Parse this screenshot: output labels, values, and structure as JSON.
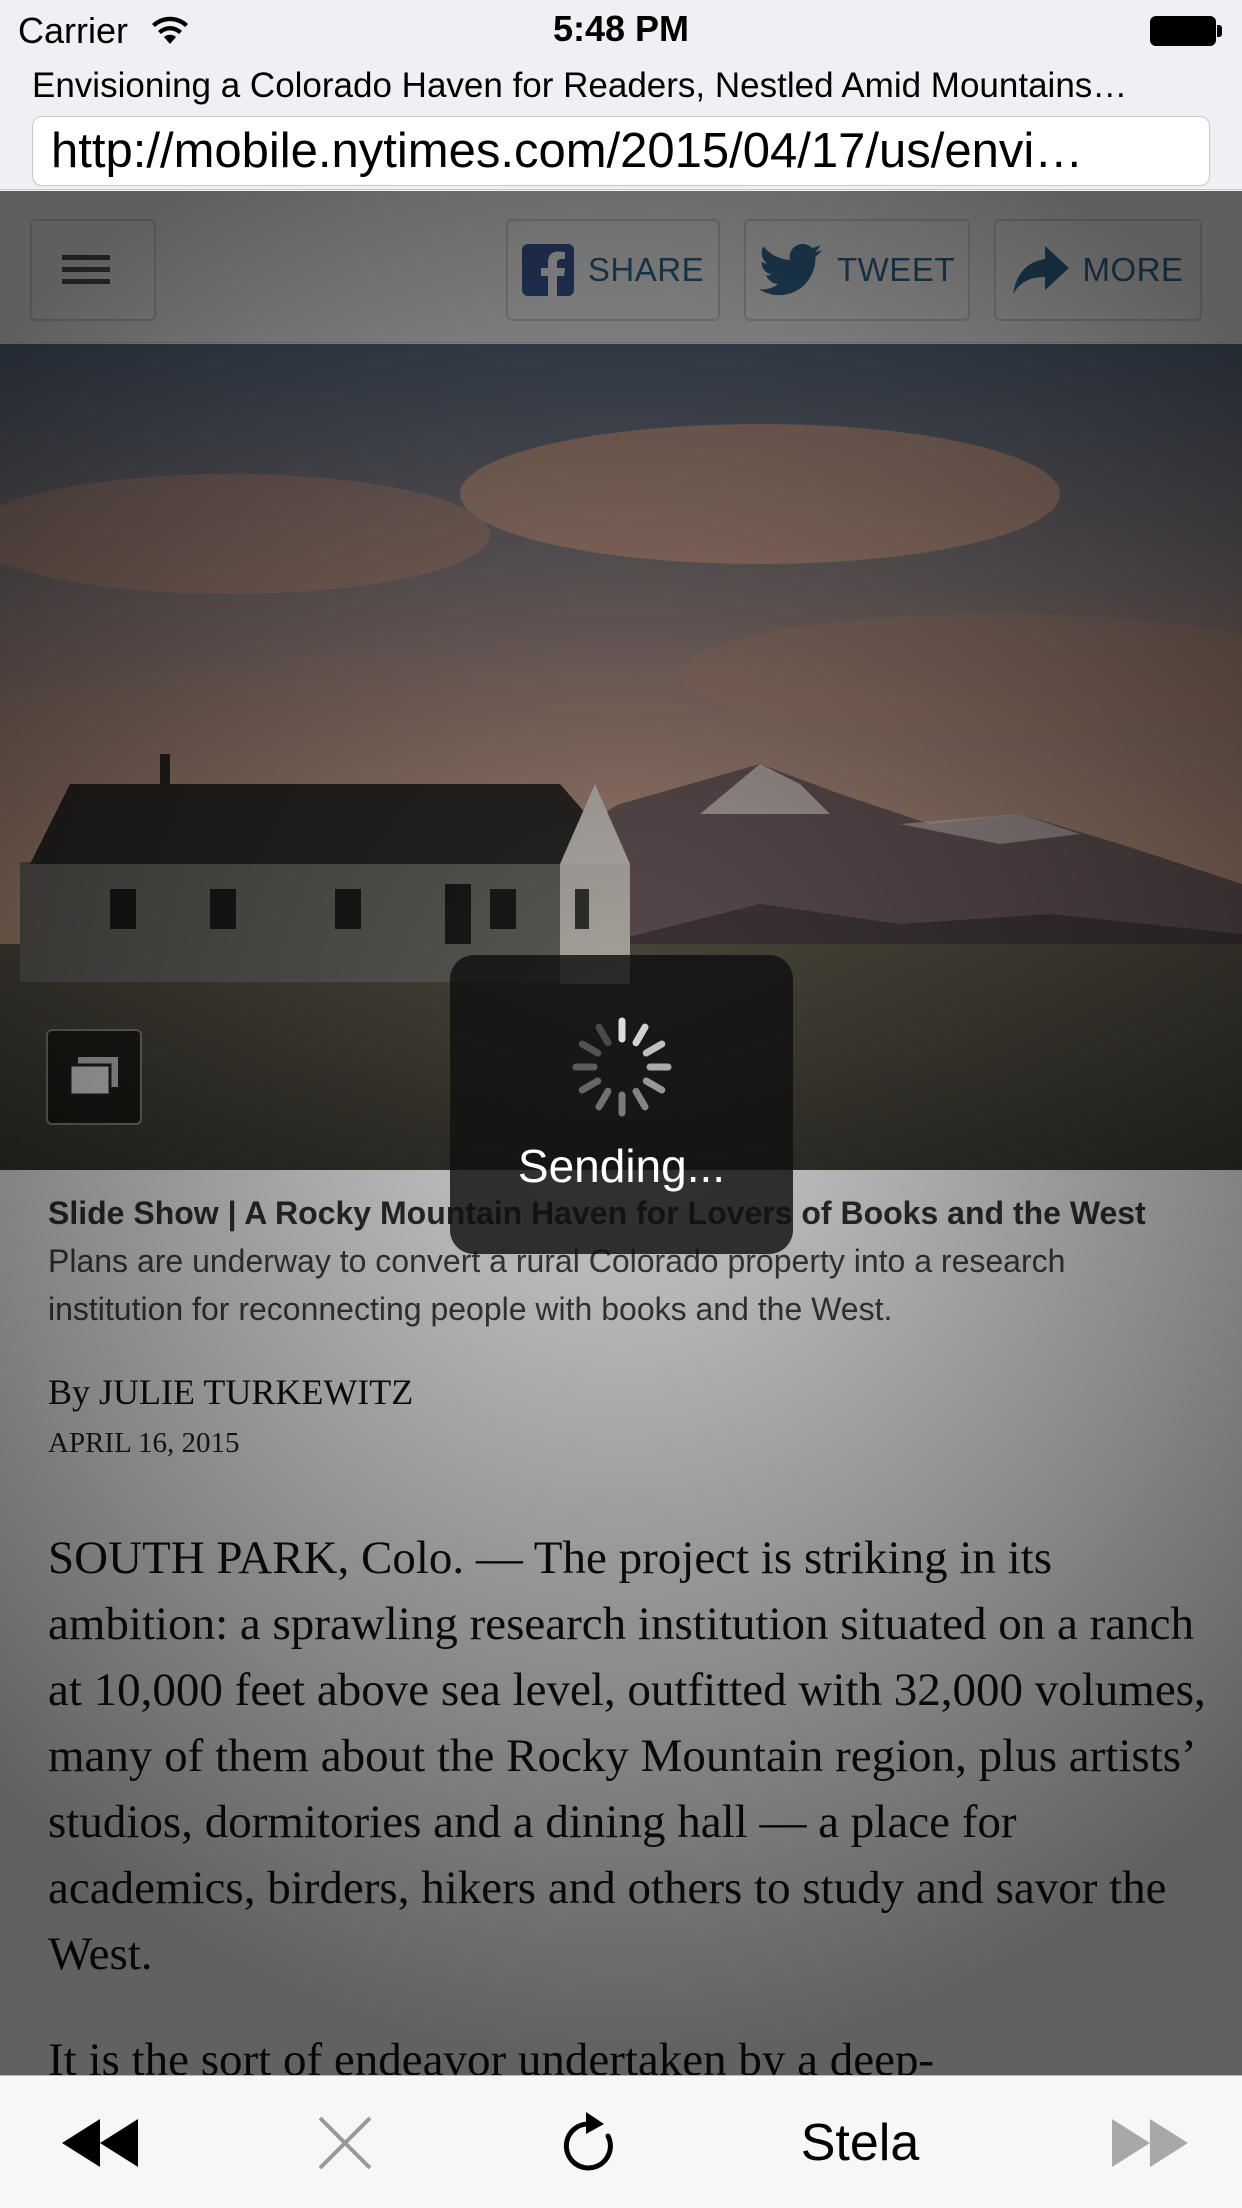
{
  "status_bar": {
    "carrier": "Carrier",
    "time": "5:48 PM",
    "wifi_icon": "wifi-icon",
    "battery_icon": "battery-icon"
  },
  "browser": {
    "page_title": "Envisioning a Colorado Haven for Readers, Nestled Amid Mountains…",
    "url": "http://mobile.nytimes.com/2015/04/17/us/envi…"
  },
  "nyt_toolbar": {
    "menu_icon": "hamburger-menu-icon",
    "share_label": "SHARE",
    "tweet_label": "TWEET",
    "more_label": "MORE"
  },
  "article": {
    "caption_title": "Slide Show | A Rocky Mountain Haven for Lovers of Books and the West",
    "caption_text": " Plans are underway to convert a rural Colorado property into a research institution for reconnecting people with books and the West.",
    "byline": "By JULIE TURKEWITZ",
    "date": "APRIL 16, 2015",
    "paragraphs": [
      "SOUTH PARK, Colo. — The project is striking in its ambition: a sprawling research institution situated on a ranch at 10,000 feet above sea level, outfitted with 32,000 volumes, many of them about the Rocky Mountain region, plus artists’ studios, dormitories and a dining hall — a place for academics, birders, hikers and others to study and savor the West.",
      "It is the sort of endeavor undertaken by a deep-"
    ]
  },
  "hud": {
    "label": "Sending..."
  },
  "bottom_bar": {
    "back_icon": "rewind-icon",
    "stop_icon": "close-icon",
    "reload_icon": "reload-icon",
    "stela_label": "Stela",
    "forward_icon": "fast-forward-icon"
  }
}
